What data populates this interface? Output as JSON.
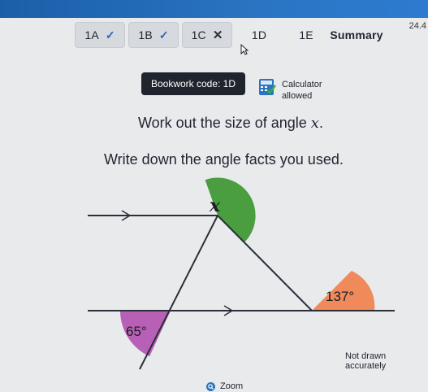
{
  "header": {
    "version": "24.4"
  },
  "tabs": [
    {
      "label": "1A",
      "status": "correct"
    },
    {
      "label": "1B",
      "status": "correct"
    },
    {
      "label": "1C",
      "status": "incorrect"
    },
    {
      "label": "1D",
      "status": "current"
    },
    {
      "label": "1E",
      "status": "pending"
    },
    {
      "label": "Summary",
      "status": "pending"
    }
  ],
  "bookwork": {
    "label": "Bookwork code: 1D"
  },
  "calculator": {
    "line1": "Calculator",
    "line2": "allowed"
  },
  "question": {
    "prefix": "Work out the size of angle ",
    "variable": "x",
    "suffix": ".",
    "instruction": "Write down the angle facts you used."
  },
  "diagram": {
    "angle_x_label": "x",
    "angle_137_label": "137°",
    "angle_65_label": "65°",
    "colors": {
      "angle_x": "#4a9e3f",
      "angle_137": "#f08a5a",
      "angle_65": "#b85fb6"
    }
  },
  "note": "Not drawn accurately",
  "zoom": {
    "label": "Zoom",
    "icon": "magnifier-icon"
  }
}
